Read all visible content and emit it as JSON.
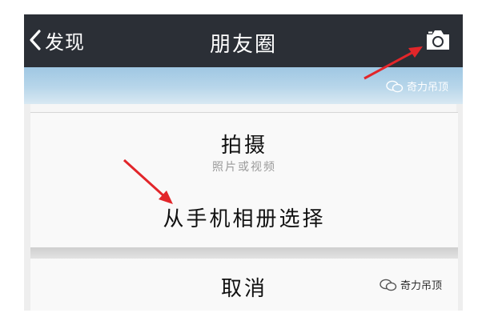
{
  "navbar": {
    "back_label": "发现",
    "title": "朋友圈",
    "back_icon": "chevron-left-icon",
    "camera_icon": "camera-icon"
  },
  "watermark": {
    "text": "奇力吊顶",
    "icon": "wechat-icon"
  },
  "action_sheet": {
    "shoot": {
      "label": "拍摄",
      "sub": "照片或视频"
    },
    "album": {
      "label": "从手机相册选择"
    },
    "cancel": {
      "label": "取消"
    }
  },
  "colors": {
    "navbar": "#2b2f36",
    "annotation_arrow": "#e2262a",
    "sheet_background": "#f9f9f9"
  }
}
